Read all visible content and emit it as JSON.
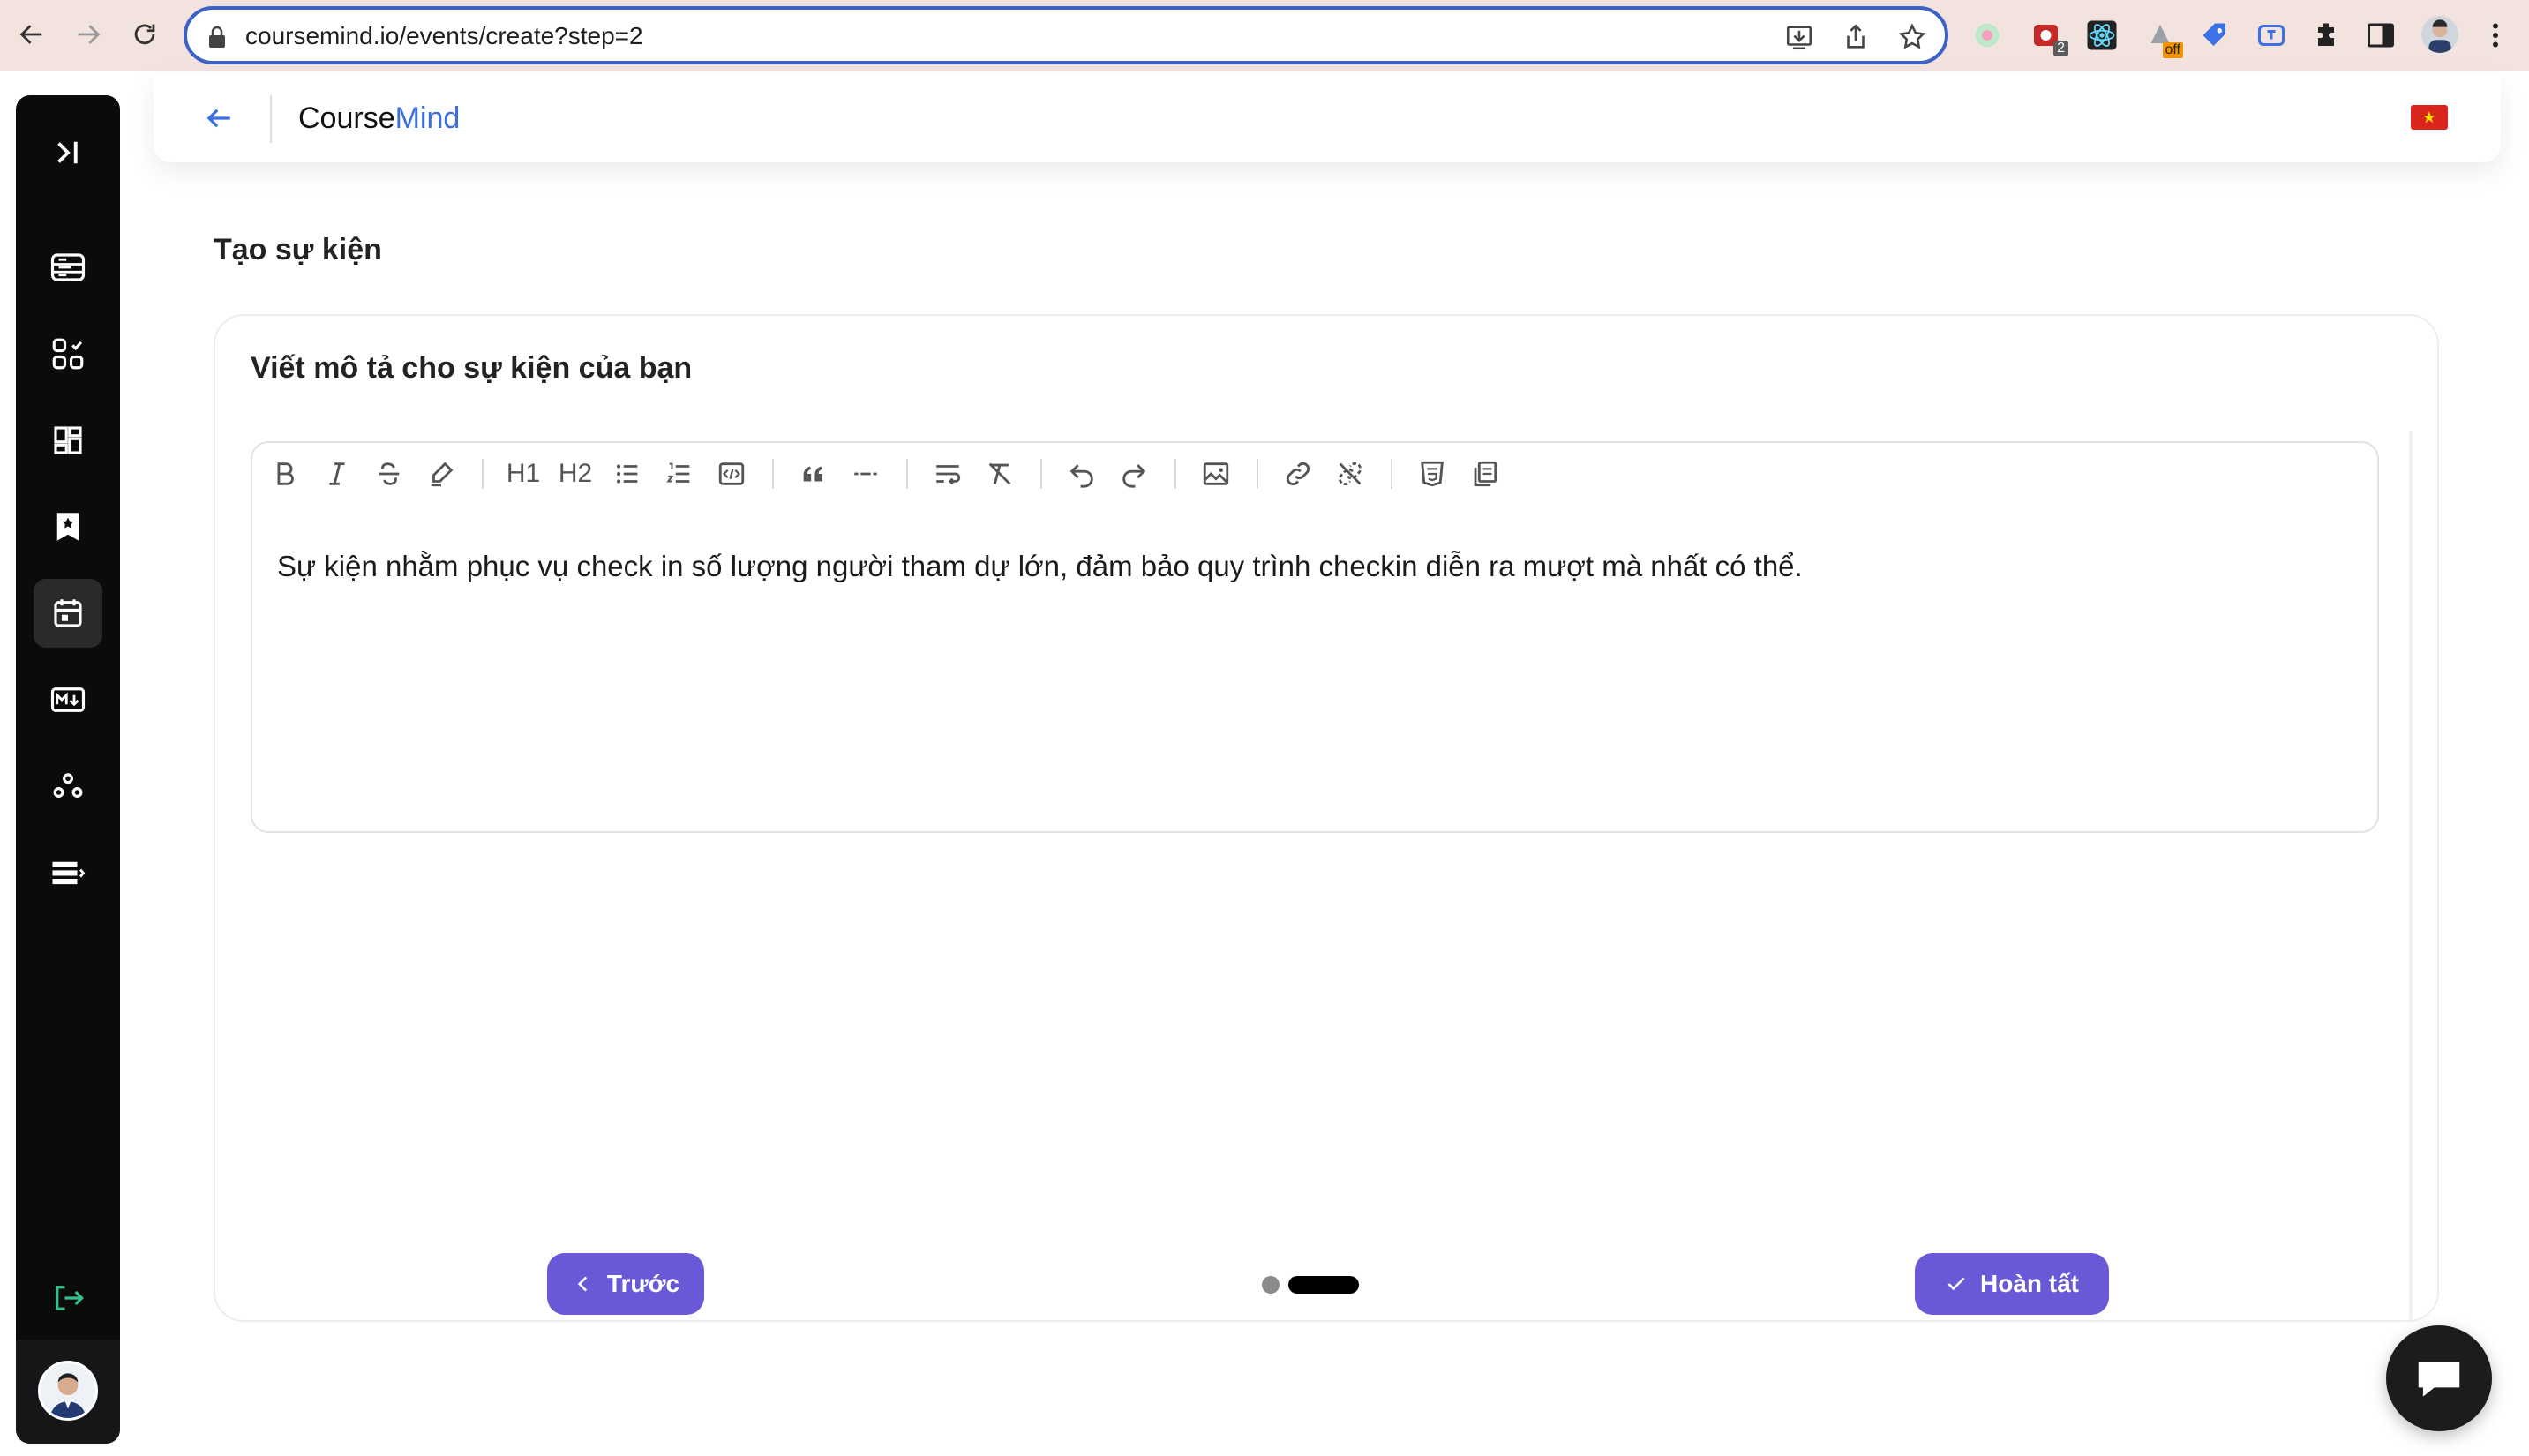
{
  "browser": {
    "url": "coursemind.io/events/create?step=2",
    "extensions": [
      {
        "icon": "color-picker-extension-icon"
      },
      {
        "icon": "record-extension-icon",
        "badge": "2"
      },
      {
        "icon": "react-devtools-icon"
      },
      {
        "icon": "extension-off-icon",
        "badge": "off"
      },
      {
        "icon": "tag-extension-icon"
      },
      {
        "icon": "translate-extension-icon"
      },
      {
        "icon": "puzzle-icon"
      },
      {
        "icon": "side-panel-icon"
      }
    ]
  },
  "app": {
    "brand_part1": "Course",
    "brand_part2": "Mind",
    "accent_color": "#3b6fe0",
    "button_color": "#6a59d6"
  },
  "sidebar": {
    "items": [
      {
        "icon": "expand-sidebar-icon"
      },
      {
        "icon": "courses-icon"
      },
      {
        "icon": "apps-icon"
      },
      {
        "icon": "dashboard-icon"
      },
      {
        "icon": "bookmark-icon"
      },
      {
        "icon": "calendar-icon",
        "active": true
      },
      {
        "icon": "markdown-icon"
      },
      {
        "icon": "community-icon"
      },
      {
        "icon": "list-icon"
      },
      {
        "icon": "logout-icon"
      }
    ]
  },
  "page": {
    "title": "Tạo sự kiện",
    "card_title": "Viết mô tả cho sự kiện của bạn",
    "editor_content": "Sự kiện nhằm phục vụ check in số lượng người tham dự lớn, đảm bảo quy trình checkin diễn ra mượt mà nhất có thể.",
    "prev_label": "Trước",
    "done_label": "Hoàn tất",
    "current_step": 2,
    "total_steps": 2
  },
  "toolbar": {
    "h1": "H1",
    "h2": "H2"
  }
}
